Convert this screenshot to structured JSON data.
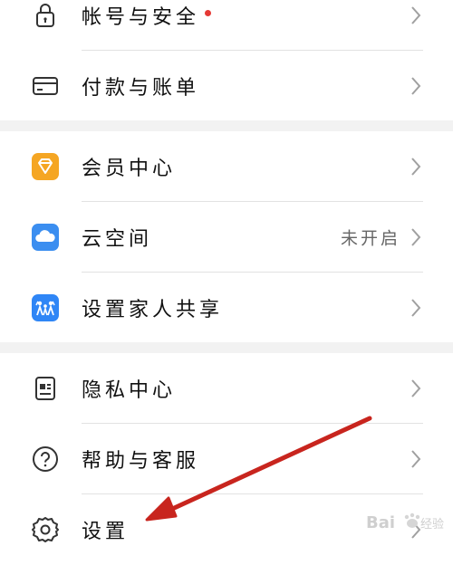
{
  "menu": {
    "account_security": {
      "label": "帐号与安全",
      "icon": "lock-icon",
      "has_badge": true
    },
    "payment_billing": {
      "label": "付款与账单",
      "icon": "card-icon"
    },
    "member_center": {
      "label": "会员中心",
      "icon": "diamond-icon"
    },
    "cloud_space": {
      "label": "云空间",
      "icon": "cloud-icon",
      "status": "未开启"
    },
    "family_sharing": {
      "label": "设置家人共享",
      "icon": "family-icon"
    },
    "privacy_center": {
      "label": "隐私中心",
      "icon": "privacy-card-icon"
    },
    "help_service": {
      "label": "帮助与客服",
      "icon": "help-icon"
    },
    "settings": {
      "label": "设置",
      "icon": "gear-icon"
    }
  },
  "colors": {
    "badge": "#e53935",
    "arrow": "#c8251e",
    "member_icon": "#f5a623",
    "cloud_icon": "#3b8ef0",
    "family_icon": "#2f86f6"
  }
}
